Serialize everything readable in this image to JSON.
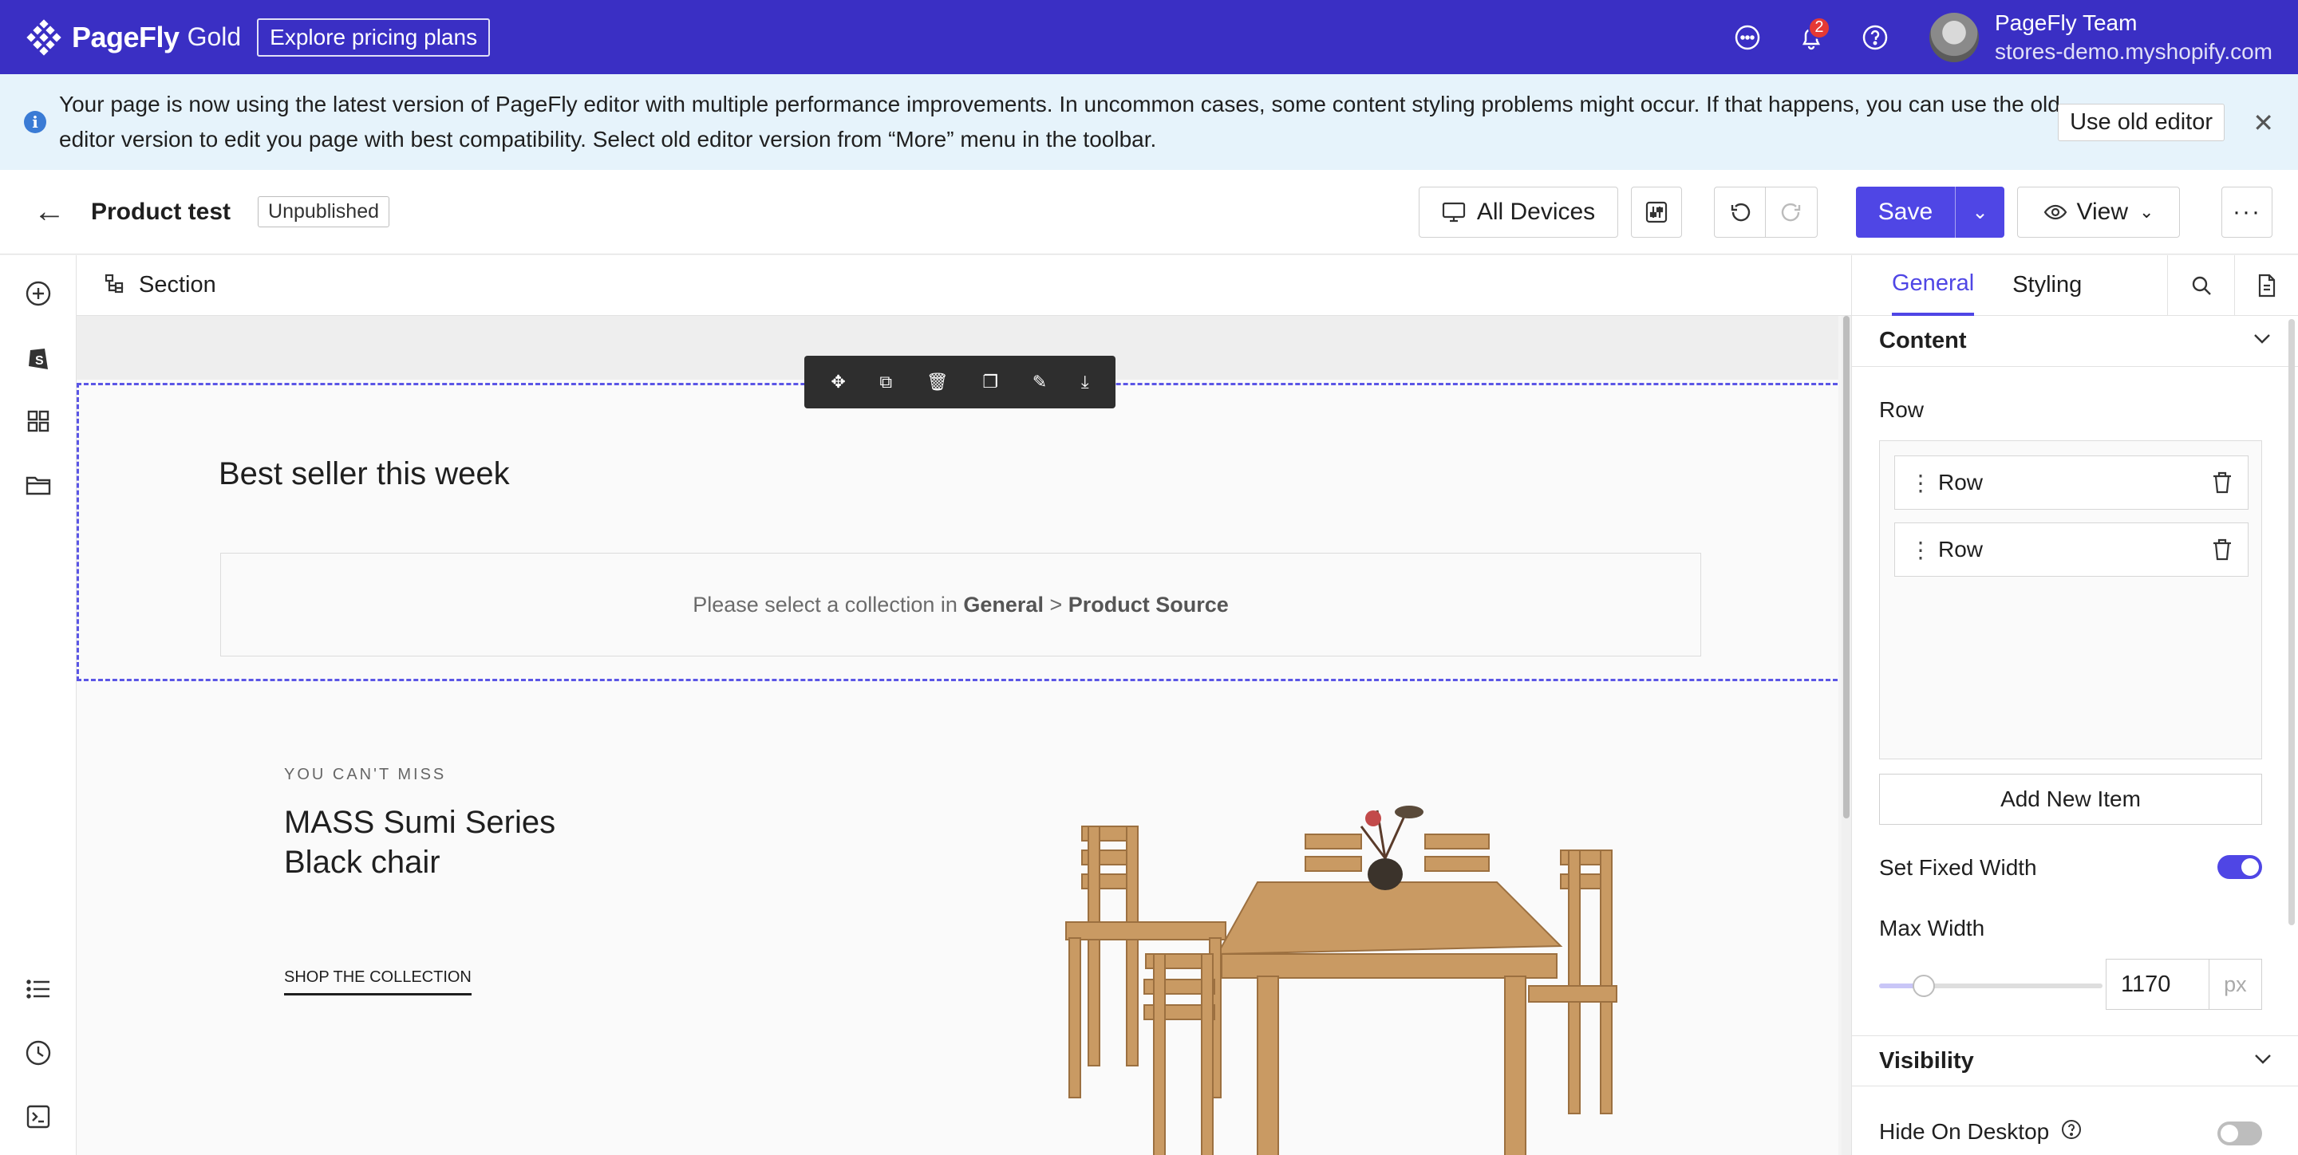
{
  "topbar": {
    "brand": "PageFly",
    "tier": "Gold",
    "pricing_label": "Explore pricing plans",
    "notification_count": "2",
    "user_name": "PageFly Team",
    "store": "stores-demo.myshopify.com",
    "bg_color": "#3a2fc4"
  },
  "notice": {
    "message": "Your page is now using the latest version of PageFly editor with multiple performance improvements. In uncommon cases, some content styling problems might occur. If that happens, you can use the old editor version to edit you page with best compatibility. Select old editor version from “More” menu in the toolbar.",
    "old_editor_label": "Use old editor",
    "close_icon": "close-icon"
  },
  "toolbar": {
    "page_name": "Product test",
    "status": "Unpublished",
    "devices_label": "All Devices",
    "save_label": "Save",
    "view_label": "View",
    "accent": "#4f46e5"
  },
  "canvas": {
    "breadcrumb": "Section",
    "section_title": "Best seller this week",
    "collection_prefix": "Please select a collection in ",
    "collection_general": "General",
    "collection_sep": " > ",
    "collection_source": "Product Source",
    "hero": {
      "kicker": "YOU CAN'T MISS",
      "title_line1": "MASS Sumi Series",
      "title_line2": "Black chair",
      "link": "SHOP THE COLLECTION"
    }
  },
  "panel": {
    "tabs": [
      "General",
      "Styling"
    ],
    "content_heading": "Content",
    "row_label": "Row",
    "items": [
      "Row",
      "Row"
    ],
    "add_label": "Add New Item",
    "fixed_width_label": "Set Fixed Width",
    "fixed_width_on": true,
    "max_width_label": "Max Width",
    "max_width_value": "1170",
    "max_width_unit": "px",
    "max_width_slider_fraction": 0.2,
    "visibility_heading": "Visibility",
    "hide_desktop_label": "Hide On Desktop",
    "hide_desktop_on": false
  }
}
